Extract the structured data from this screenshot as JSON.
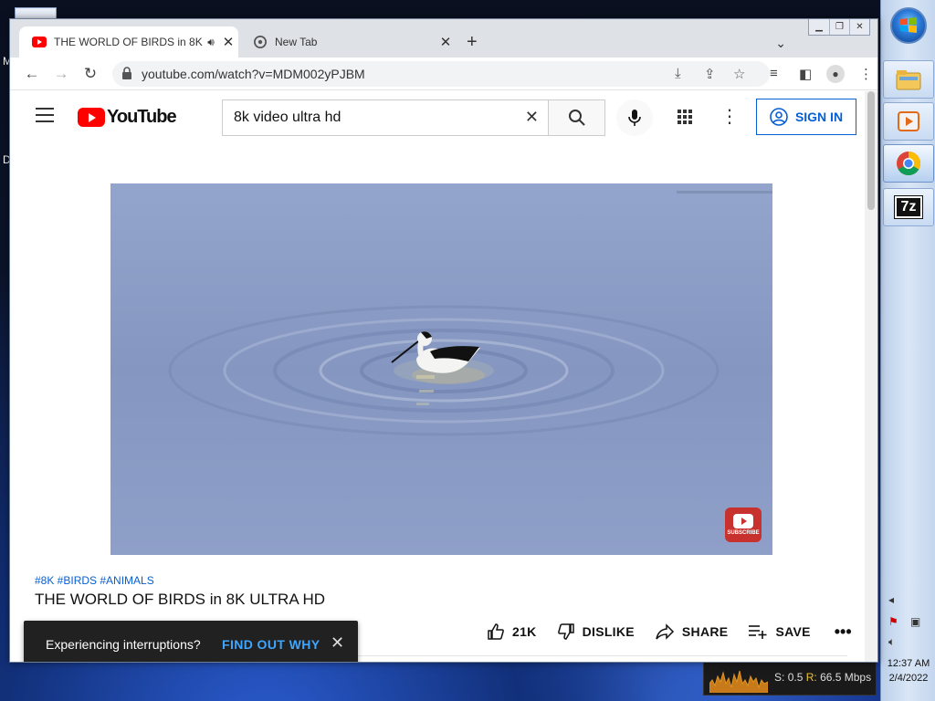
{
  "browser": {
    "tabs": [
      {
        "title": "THE WORLD OF BIRDS in 8K",
        "active": true
      },
      {
        "title": "New Tab",
        "active": false
      }
    ],
    "url": "youtube.com/watch?v=MDM002yPJBM"
  },
  "youtube": {
    "logo_text": "YouTube",
    "search_query": "8k video ultra hd",
    "sign_in_label": "SIGN IN",
    "video": {
      "hashtags": "#8K #BIRDS #ANIMALS",
      "title": "THE WORLD OF BIRDS in 8K ULTRA HD",
      "subscribe_badge": "SUBSCRIBE",
      "likes": "21K",
      "dislike_label": "DISLIKE",
      "share_label": "SHARE",
      "save_label": "SAVE"
    },
    "toast": {
      "message": "Experiencing interruptions?",
      "action": "FIND OUT WHY"
    }
  },
  "network_meter": {
    "send_label": "S:",
    "send_value": "0.5",
    "recv_label": "R:",
    "recv_value": "66.5 Mbps"
  },
  "taskbar": {
    "time": "12:37 AM",
    "date": "2/4/2022",
    "apps": [
      "windows-explorer",
      "media-player",
      "chrome",
      "7-zip"
    ],
    "seven_zip_label": "7z"
  },
  "desktop": {
    "edge_glyphs": [
      "M",
      "D"
    ]
  },
  "colors": {
    "youtube_red": "#ff0000",
    "link_blue": "#065fd4",
    "toast_action": "#3ea6ff"
  }
}
